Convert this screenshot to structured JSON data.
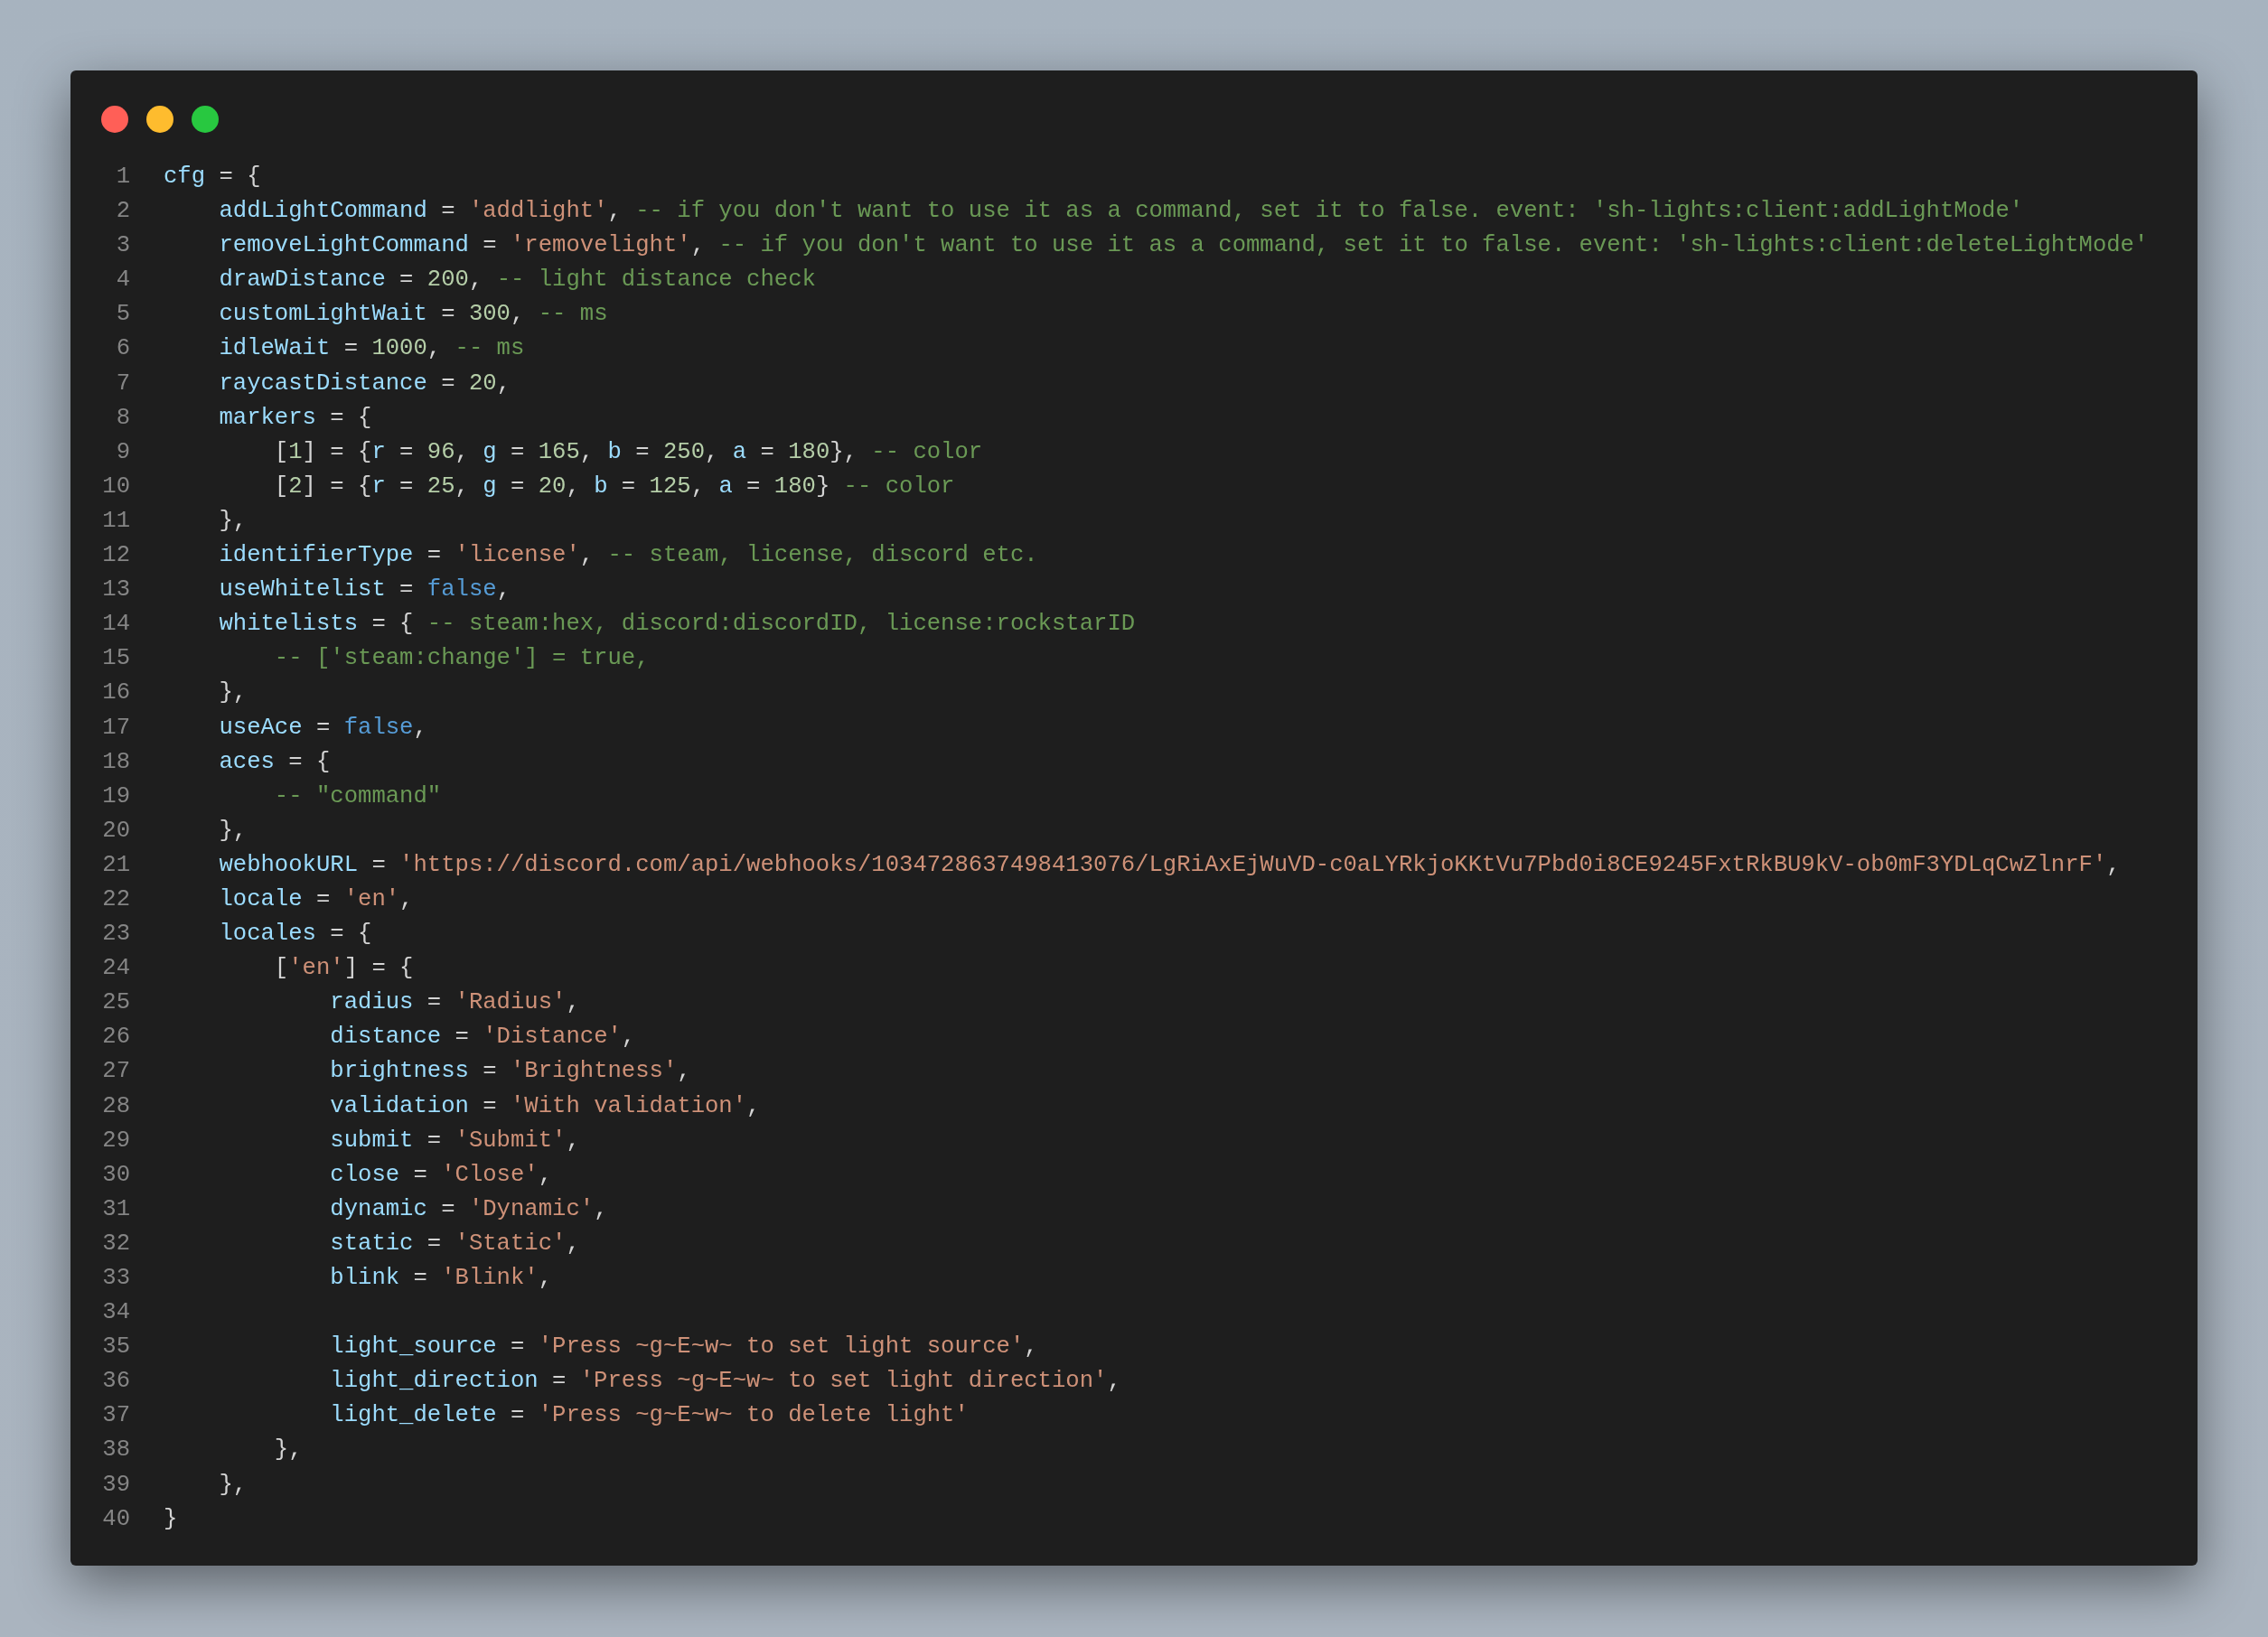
{
  "window": {
    "controls": [
      {
        "kind": "close"
      },
      {
        "kind": "minimize"
      },
      {
        "kind": "maximize"
      }
    ]
  },
  "code": {
    "lines": [
      {
        "number": "1",
        "tokens": [
          {
            "kind": "name",
            "text": "cfg"
          },
          {
            "kind": "punct",
            "text": " = {"
          }
        ]
      },
      {
        "number": "2",
        "tokens": [
          {
            "kind": "name",
            "text": "    addLightCommand"
          },
          {
            "kind": "punct",
            "text": " = "
          },
          {
            "kind": "string",
            "text": "'addlight'"
          },
          {
            "kind": "punct",
            "text": ", "
          },
          {
            "kind": "comment",
            "text": "-- if you don't want to use it as a command, set it to false. event: 'sh-lights:client:addLightMode'"
          }
        ]
      },
      {
        "number": "3",
        "tokens": [
          {
            "kind": "name",
            "text": "    removeLightCommand"
          },
          {
            "kind": "punct",
            "text": " = "
          },
          {
            "kind": "string",
            "text": "'removelight'"
          },
          {
            "kind": "punct",
            "text": ", "
          },
          {
            "kind": "comment",
            "text": "-- if you don't want to use it as a command, set it to false. event: 'sh-lights:client:deleteLightMode'"
          }
        ]
      },
      {
        "number": "4",
        "tokens": [
          {
            "kind": "name",
            "text": "    drawDistance"
          },
          {
            "kind": "punct",
            "text": " = "
          },
          {
            "kind": "number",
            "text": "200"
          },
          {
            "kind": "punct",
            "text": ", "
          },
          {
            "kind": "comment",
            "text": "-- light distance check"
          }
        ]
      },
      {
        "number": "5",
        "tokens": [
          {
            "kind": "name",
            "text": "    customLightWait"
          },
          {
            "kind": "punct",
            "text": " = "
          },
          {
            "kind": "number",
            "text": "300"
          },
          {
            "kind": "punct",
            "text": ", "
          },
          {
            "kind": "comment",
            "text": "-- ms"
          }
        ]
      },
      {
        "number": "6",
        "tokens": [
          {
            "kind": "name",
            "text": "    idleWait"
          },
          {
            "kind": "punct",
            "text": " = "
          },
          {
            "kind": "number",
            "text": "1000"
          },
          {
            "kind": "punct",
            "text": ", "
          },
          {
            "kind": "comment",
            "text": "-- ms"
          }
        ]
      },
      {
        "number": "7",
        "tokens": [
          {
            "kind": "name",
            "text": "    raycastDistance"
          },
          {
            "kind": "punct",
            "text": " = "
          },
          {
            "kind": "number",
            "text": "20"
          },
          {
            "kind": "punct",
            "text": ","
          }
        ]
      },
      {
        "number": "8",
        "tokens": [
          {
            "kind": "name",
            "text": "    markers"
          },
          {
            "kind": "punct",
            "text": " = {"
          }
        ]
      },
      {
        "number": "9",
        "tokens": [
          {
            "kind": "punct",
            "text": "        ["
          },
          {
            "kind": "number",
            "text": "1"
          },
          {
            "kind": "punct",
            "text": "] = {"
          },
          {
            "kind": "name",
            "text": "r"
          },
          {
            "kind": "punct",
            "text": " = "
          },
          {
            "kind": "number",
            "text": "96"
          },
          {
            "kind": "punct",
            "text": ", "
          },
          {
            "kind": "name",
            "text": "g"
          },
          {
            "kind": "punct",
            "text": " = "
          },
          {
            "kind": "number",
            "text": "165"
          },
          {
            "kind": "punct",
            "text": ", "
          },
          {
            "kind": "name",
            "text": "b"
          },
          {
            "kind": "punct",
            "text": " = "
          },
          {
            "kind": "number",
            "text": "250"
          },
          {
            "kind": "punct",
            "text": ", "
          },
          {
            "kind": "name",
            "text": "a"
          },
          {
            "kind": "punct",
            "text": " = "
          },
          {
            "kind": "number",
            "text": "180"
          },
          {
            "kind": "punct",
            "text": "}, "
          },
          {
            "kind": "comment",
            "text": "-- color"
          }
        ]
      },
      {
        "number": "10",
        "tokens": [
          {
            "kind": "punct",
            "text": "        ["
          },
          {
            "kind": "number",
            "text": "2"
          },
          {
            "kind": "punct",
            "text": "] = {"
          },
          {
            "kind": "name",
            "text": "r"
          },
          {
            "kind": "punct",
            "text": " = "
          },
          {
            "kind": "number",
            "text": "25"
          },
          {
            "kind": "punct",
            "text": ", "
          },
          {
            "kind": "name",
            "text": "g"
          },
          {
            "kind": "punct",
            "text": " = "
          },
          {
            "kind": "number",
            "text": "20"
          },
          {
            "kind": "punct",
            "text": ", "
          },
          {
            "kind": "name",
            "text": "b"
          },
          {
            "kind": "punct",
            "text": " = "
          },
          {
            "kind": "number",
            "text": "125"
          },
          {
            "kind": "punct",
            "text": ", "
          },
          {
            "kind": "name",
            "text": "a"
          },
          {
            "kind": "punct",
            "text": " = "
          },
          {
            "kind": "number",
            "text": "180"
          },
          {
            "kind": "punct",
            "text": "} "
          },
          {
            "kind": "comment",
            "text": "-- color"
          }
        ]
      },
      {
        "number": "11",
        "tokens": [
          {
            "kind": "punct",
            "text": "    },"
          }
        ]
      },
      {
        "number": "12",
        "tokens": [
          {
            "kind": "name",
            "text": "    identifierType"
          },
          {
            "kind": "punct",
            "text": " = "
          },
          {
            "kind": "string",
            "text": "'license'"
          },
          {
            "kind": "punct",
            "text": ", "
          },
          {
            "kind": "comment",
            "text": "-- steam, license, discord etc."
          }
        ]
      },
      {
        "number": "13",
        "tokens": [
          {
            "kind": "name",
            "text": "    useWhitelist"
          },
          {
            "kind": "punct",
            "text": " = "
          },
          {
            "kind": "keyword",
            "text": "false"
          },
          {
            "kind": "punct",
            "text": ","
          }
        ]
      },
      {
        "number": "14",
        "tokens": [
          {
            "kind": "name",
            "text": "    whitelists"
          },
          {
            "kind": "punct",
            "text": " = { "
          },
          {
            "kind": "comment",
            "text": "-- steam:hex, discord:discordID, license:rockstarID"
          }
        ]
      },
      {
        "number": "15",
        "tokens": [
          {
            "kind": "comment",
            "text": "        -- ['steam:change'] = true,"
          }
        ]
      },
      {
        "number": "16",
        "tokens": [
          {
            "kind": "punct",
            "text": "    },"
          }
        ]
      },
      {
        "number": "17",
        "tokens": [
          {
            "kind": "name",
            "text": "    useAce"
          },
          {
            "kind": "punct",
            "text": " = "
          },
          {
            "kind": "keyword",
            "text": "false"
          },
          {
            "kind": "punct",
            "text": ","
          }
        ]
      },
      {
        "number": "18",
        "tokens": [
          {
            "kind": "name",
            "text": "    aces"
          },
          {
            "kind": "punct",
            "text": " = {"
          }
        ]
      },
      {
        "number": "19",
        "tokens": [
          {
            "kind": "comment",
            "text": "        -- \"command\""
          }
        ]
      },
      {
        "number": "20",
        "tokens": [
          {
            "kind": "punct",
            "text": "    },"
          }
        ]
      },
      {
        "number": "21",
        "tokens": [
          {
            "kind": "name",
            "text": "    webhookURL"
          },
          {
            "kind": "punct",
            "text": " = "
          },
          {
            "kind": "string",
            "text": "'https://discord.com/api/webhooks/1034728637498413076/LgRiAxEjWuVD-c0aLYRkjoKKtVu7Pbd0i8CE9245FxtRkBU9kV-ob0mF3YDLqCwZlnrF'"
          },
          {
            "kind": "punct",
            "text": ","
          }
        ]
      },
      {
        "number": "22",
        "tokens": [
          {
            "kind": "name",
            "text": "    locale"
          },
          {
            "kind": "punct",
            "text": " = "
          },
          {
            "kind": "string",
            "text": "'en'"
          },
          {
            "kind": "punct",
            "text": ","
          }
        ]
      },
      {
        "number": "23",
        "tokens": [
          {
            "kind": "name",
            "text": "    locales"
          },
          {
            "kind": "punct",
            "text": " = {"
          }
        ]
      },
      {
        "number": "24",
        "tokens": [
          {
            "kind": "punct",
            "text": "        ["
          },
          {
            "kind": "string",
            "text": "'en'"
          },
          {
            "kind": "punct",
            "text": "] = {"
          }
        ]
      },
      {
        "number": "25",
        "tokens": [
          {
            "kind": "name",
            "text": "            radius"
          },
          {
            "kind": "punct",
            "text": " = "
          },
          {
            "kind": "string",
            "text": "'Radius'"
          },
          {
            "kind": "punct",
            "text": ","
          }
        ]
      },
      {
        "number": "26",
        "tokens": [
          {
            "kind": "name",
            "text": "            distance"
          },
          {
            "kind": "punct",
            "text": " = "
          },
          {
            "kind": "string",
            "text": "'Distance'"
          },
          {
            "kind": "punct",
            "text": ","
          }
        ]
      },
      {
        "number": "27",
        "tokens": [
          {
            "kind": "name",
            "text": "            brightness"
          },
          {
            "kind": "punct",
            "text": " = "
          },
          {
            "kind": "string",
            "text": "'Brightness'"
          },
          {
            "kind": "punct",
            "text": ","
          }
        ]
      },
      {
        "number": "28",
        "tokens": [
          {
            "kind": "name",
            "text": "            validation"
          },
          {
            "kind": "punct",
            "text": " = "
          },
          {
            "kind": "string",
            "text": "'With validation'"
          },
          {
            "kind": "punct",
            "text": ","
          }
        ]
      },
      {
        "number": "29",
        "tokens": [
          {
            "kind": "name",
            "text": "            submit"
          },
          {
            "kind": "punct",
            "text": " = "
          },
          {
            "kind": "string",
            "text": "'Submit'"
          },
          {
            "kind": "punct",
            "text": ","
          }
        ]
      },
      {
        "number": "30",
        "tokens": [
          {
            "kind": "name",
            "text": "            close"
          },
          {
            "kind": "punct",
            "text": " = "
          },
          {
            "kind": "string",
            "text": "'Close'"
          },
          {
            "kind": "punct",
            "text": ","
          }
        ]
      },
      {
        "number": "31",
        "tokens": [
          {
            "kind": "name",
            "text": "            dynamic"
          },
          {
            "kind": "punct",
            "text": " = "
          },
          {
            "kind": "string",
            "text": "'Dynamic'"
          },
          {
            "kind": "punct",
            "text": ","
          }
        ]
      },
      {
        "number": "32",
        "tokens": [
          {
            "kind": "name",
            "text": "            static"
          },
          {
            "kind": "punct",
            "text": " = "
          },
          {
            "kind": "string",
            "text": "'Static'"
          },
          {
            "kind": "punct",
            "text": ","
          }
        ]
      },
      {
        "number": "33",
        "tokens": [
          {
            "kind": "name",
            "text": "            blink"
          },
          {
            "kind": "punct",
            "text": " = "
          },
          {
            "kind": "string",
            "text": "'Blink'"
          },
          {
            "kind": "punct",
            "text": ","
          }
        ]
      },
      {
        "number": "34"
      },
      {
        "number": "35",
        "tokens": [
          {
            "kind": "name",
            "text": "            light_source"
          },
          {
            "kind": "punct",
            "text": " = "
          },
          {
            "kind": "string",
            "text": "'Press ~g~E~w~ to set light source'"
          },
          {
            "kind": "punct",
            "text": ","
          }
        ]
      },
      {
        "number": "36",
        "tokens": [
          {
            "kind": "name",
            "text": "            light_direction"
          },
          {
            "kind": "punct",
            "text": " = "
          },
          {
            "kind": "string",
            "text": "'Press ~g~E~w~ to set light direction'"
          },
          {
            "kind": "punct",
            "text": ","
          }
        ]
      },
      {
        "number": "37",
        "tokens": [
          {
            "kind": "name",
            "text": "            light_delete"
          },
          {
            "kind": "punct",
            "text": " = "
          },
          {
            "kind": "string",
            "text": "'Press ~g~E~w~ to delete light'"
          }
        ]
      },
      {
        "number": "38",
        "tokens": [
          {
            "kind": "punct",
            "text": "        },"
          }
        ]
      },
      {
        "number": "39",
        "tokens": [
          {
            "kind": "punct",
            "text": "    },"
          }
        ]
      },
      {
        "number": "40",
        "tokens": [
          {
            "kind": "punct",
            "text": "}"
          }
        ]
      }
    ]
  }
}
